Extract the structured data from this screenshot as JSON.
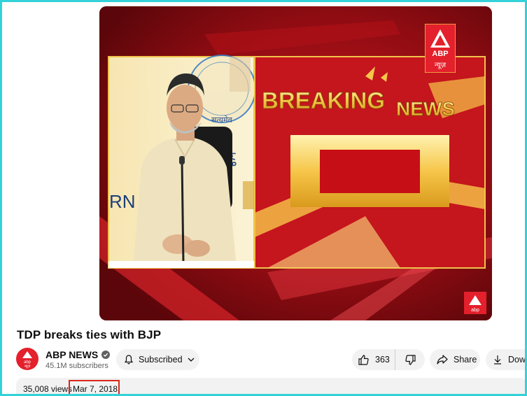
{
  "video": {
    "title": "TDP breaks ties with BJP",
    "frame": {
      "breaking_word": "BREAKING",
      "news_word": "NEWS",
      "partial_wall_text": "RN",
      "emblem_text": "सत्यमेव",
      "logo_text": "ABP",
      "logo_subtext": "न्यूज़",
      "small_logo_text": "abp"
    }
  },
  "channel": {
    "name": "ABP NEWS",
    "subscribers": "45.1M subscribers",
    "avatar_text": "abp",
    "avatar_subtext": "न्यूज़"
  },
  "actions": {
    "subscribed_label": "Subscribed",
    "like_count": "363",
    "share_label": "Share",
    "download_label": "Download"
  },
  "description": {
    "views": "35,008 views",
    "date": "Mar 7, 2018"
  },
  "colors": {
    "accent_red": "#d9261c",
    "highlight_border": "#33d2d8",
    "pill_bg": "#f2f2f2"
  },
  "icons": [
    "verified-icon",
    "bell-icon",
    "chevron-down-icon",
    "thumbs-up-icon",
    "thumbs-down-icon",
    "share-icon",
    "download-icon"
  ]
}
